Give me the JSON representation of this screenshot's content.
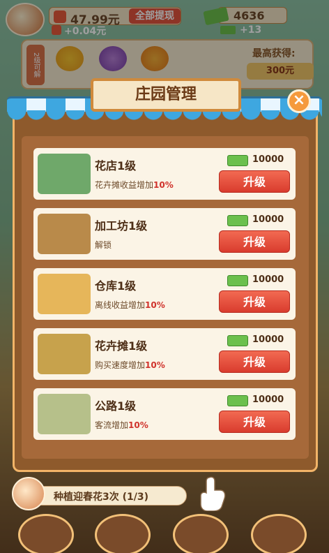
{
  "hud": {
    "cash_value": "47.99元",
    "withdraw_label": "全部提现",
    "cash_delta": "+0.04元",
    "money_value": "4636",
    "money_delta": "+13"
  },
  "seed_strip": {
    "tag": "2级可解",
    "best_label": "最高获得:",
    "best_value": "300元"
  },
  "modal": {
    "title": "庄园管理",
    "close_symbol": "×",
    "items": [
      {
        "name": "花店1级",
        "desc_prefix": "花卉摊收益增加",
        "desc_highlight": "10%",
        "cost": "10000",
        "button": "升级",
        "thumb_color": "#6fa86a"
      },
      {
        "name": "加工坊1级",
        "desc_prefix": "解锁",
        "desc_highlight": "",
        "cost": "10000",
        "button": "升级",
        "thumb_color": "#b98a4a"
      },
      {
        "name": "仓库1级",
        "desc_prefix": "离线收益增加",
        "desc_highlight": "10%",
        "cost": "10000",
        "button": "升级",
        "thumb_color": "#e6b65a"
      },
      {
        "name": "花卉摊1级",
        "desc_prefix": "购买速度增加",
        "desc_highlight": "10%",
        "cost": "10000",
        "button": "升级",
        "thumb_color": "#c7a24c"
      },
      {
        "name": "公路1级",
        "desc_prefix": "客流增加",
        "desc_highlight": "10%",
        "cost": "10000",
        "button": "升级",
        "thumb_color": "#b6c08a"
      }
    ]
  },
  "task": {
    "text": "种植迎春花3次 (1/3)"
  },
  "colors": {
    "accent_red": "#d93c2e",
    "highlight_red": "#d0332c",
    "money_green": "#6cc04d",
    "frame_brown": "#8e5a2c"
  }
}
